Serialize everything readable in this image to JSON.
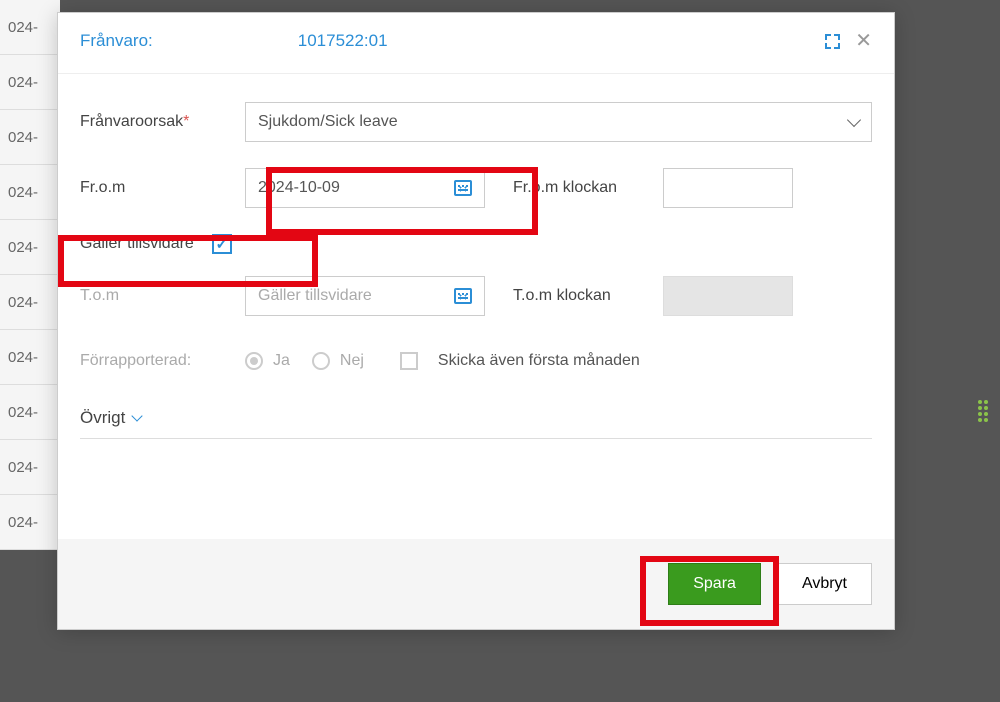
{
  "bgRowText": "024-",
  "header": {
    "title": "Frånvaro:",
    "id": "1017522:01"
  },
  "form": {
    "reasonLabel": "Frånvaroorsak",
    "reasonValue": "Sjukdom/Sick leave",
    "fromLabel": "Fr.o.m",
    "fromDate": "2024-10-09",
    "fromTimeLabel": "Fr.o.m klockan",
    "tillsvidareLabel": "Gäller tillsvidare",
    "tomLabel": "T.o.m",
    "tomPlaceholder": "Gäller tillsvidare",
    "tomTimeLabel": "T.o.m klockan",
    "prereportLabel": "Förrapporterad:",
    "yesLabel": "Ja",
    "noLabel": "Nej",
    "sendFirstLabel": "Skicka även första månaden",
    "ovrigtLabel": "Övrigt"
  },
  "footer": {
    "save": "Spara",
    "cancel": "Avbryt"
  }
}
